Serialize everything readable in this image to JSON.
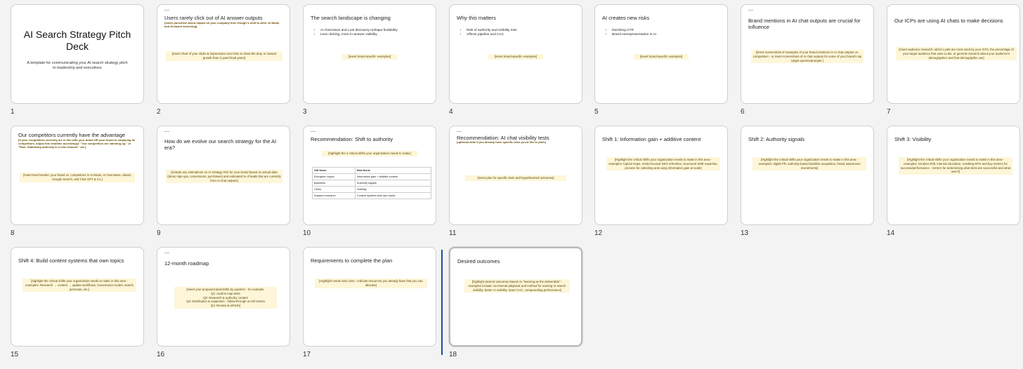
{
  "slides": [
    {
      "num": "1",
      "title": "AI Search Strategy Pitch Deck",
      "subtitle": "A template for communicating your AI search strategy pitch to leadership and executives"
    },
    {
      "num": "2",
      "title": "Users rarely click out of AI answer outputs",
      "note": "[insert punchline about impact on your company from Google's shift to AIOs, AI Mode, and AI-based searching]",
      "placeholder": "[insert chart of your clicks & impressions over time to show the drop or slowed growth than in past fiscal years]"
    },
    {
      "num": "3",
      "title": "The search landscape is changing",
      "bullets": [
        "AI Overviews and LLM discovery reshape findability",
        "Less clicking, more in-answer visibility"
      ],
      "placeholder": "[insert brand-specific examples]"
    },
    {
      "num": "4",
      "title": "Why this matters",
      "bullets": [
        "Risk of authority and visibility loss",
        "Affects pipeline and CAC"
      ],
      "placeholder": "[insert brand-specific examples]"
    },
    {
      "num": "5",
      "title": "AI creates new risks",
      "bullets": [
        "Declining CTR",
        "Brand misrepresentation in AI"
      ],
      "placeholder": "[insert brand-specific examples]"
    },
    {
      "num": "6",
      "title": "Brand mentions in AI chat outputs are crucial for influence",
      "placeholder": "[insert screenshots of examples of your brand mentions in AI chat outputs vs. competitors - or insert screenshots of AI chat outputs for some of your brand's top target queries/prompts ]"
    },
    {
      "num": "7",
      "title": "Our ICPs are using AI chats to make decisions",
      "placeholder": "[insert audience research: which LLMs are most used by your ICPs, the percentage of your target audience that uses LLMs, or general research about your audience's demographics and that demographic use]"
    },
    {
      "num": "8",
      "title": "Our competitors currently have the advantage",
      "note": "[if your competitors currently are in line with your brand OR your brand is outpacing its competitors, adjust this headline accordingly: \"Our competitors are catching up,\" or \"Risk: Stabilizing authority in a new channel,\" etc.]",
      "placeholder": "[insert benchmarks: your brand vs. competitors in AI Mode, AI Overviews, classic Google Search, and Chat GPT & Co.]"
    },
    {
      "num": "9",
      "title": "How do we evolve our search strategy for the AI era?",
      "placeholder": "[include any estimations on AI strategy ROI for your brand based on actual data (demo sign-ups, conversions, purchases) and estimated % of leads that are currently from AI chat outputs]"
    },
    {
      "num": "10",
      "title": "Recommendation: Shift to authority",
      "placeholder": "[highlight the 4 critical shifts your organization needs to make]",
      "table": {
        "headers": [
          "Old focus",
          "New focus"
        ],
        "rows": [
          [
            "Evergreen topics",
            "Information gain + additive content"
          ],
          [
            "Backlinks",
            "Authority signals"
          ],
          [
            "Clicks",
            "Visibility"
          ],
          [
            "Keyword research",
            "Content systems that own topics"
          ]
        ]
      }
    },
    {
      "num": "11",
      "title": "Recommendation: AI chat visibility tests",
      "note": "(optional slide if you already have specific tests you'd like to pitch)",
      "placeholder": "[insert plan for specific tests and hypothesized outcomes]"
    },
    {
      "num": "12",
      "title": "Shift 1: Information gain + additive content",
      "placeholder": "[Highlight the critical shifts your organization needs to make in this area - examples: topical maps, entity-focused SEO refreshes, structured SME expertise, process for collecting and using information gain at scale]"
    },
    {
      "num": "13",
      "title": "Shift 2: Authority signals",
      "placeholder": "[Highlight the critical shifts your organization needs to make in this area - examples: digital PR, authority-based backlink acquisition, brand awareness investments]"
    },
    {
      "num": "14",
      "title": "Shift 3: Visibility",
      "placeholder": "[Highlight the critical shifts your organization needs to make in this area - examples: mindset shift, internal education, resetting KPIs and key metrics for success/performance - metrics for determining what tests are successful and what aren't]"
    },
    {
      "num": "15",
      "title": "Shift 4: Build content systems that own topics",
      "placeholder": "[highlight the critical shifts your organization needs to make in this area - examples: Research → content → update workflows, Governance model, search personas, etc.]"
    },
    {
      "num": "16",
      "title": "12-month roadmap",
      "placeholder": "[insert your proposed plan/shifts by quarters - for example:\nQ1: Audit & map tests\nQ2: Research & authority content\nQ3: Distribution & expansion - follow-through on kill criteria\nQ4: Review & refresh]"
    },
    {
      "num": "17",
      "title": "Requirements to complete the plan",
      "placeholder": "[Highlight needs and costs - indicate resources you already have that you can allocate]"
    },
    {
      "num": "18",
      "title": "Desired outcomes",
      "placeholder": "[highlight desired outcomes based on \"learning as the deliverable\" - examples include: an internal playbook and  method for earning AI search visibility, better AI visibility, lower CAC, compounding performance]"
    }
  ]
}
